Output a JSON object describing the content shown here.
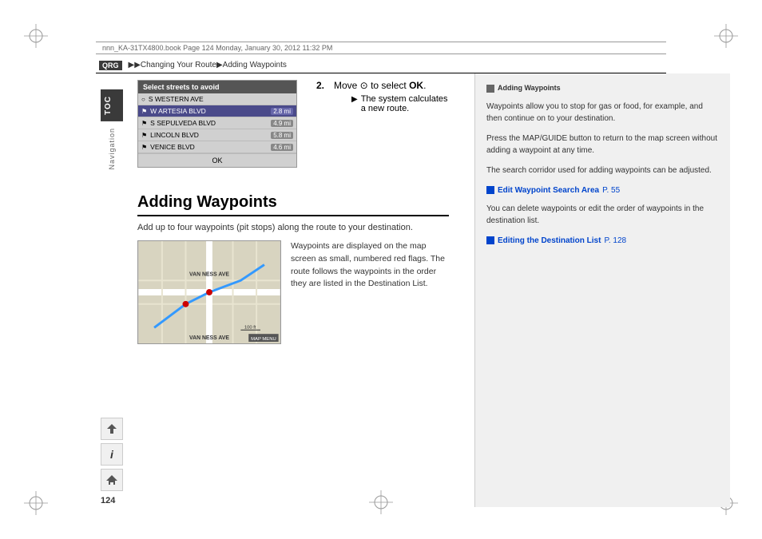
{
  "meta": {
    "file_info": "nnn_KA-31TX4800.book  Page 124  Monday, January 30, 2012  11:32 PM"
  },
  "header": {
    "qrg_label": "QRG",
    "breadcrumb": "▶▶Changing Your Route▶Adding Waypoints"
  },
  "sidebar": {
    "toc_label": "TOC",
    "nav_label": "Navigation",
    "icons": [
      "↗",
      "i",
      "Home"
    ],
    "page_number": "124"
  },
  "step2": {
    "label": "2.",
    "text": "Move  to select OK.",
    "joystick": "⊙",
    "ok": "OK",
    "substep": "The system calculates a new route."
  },
  "select_streets": {
    "title": "Select streets to avoid",
    "streets": [
      {
        "icon": "○",
        "name": "S WESTERN AVE",
        "distance": "",
        "selected": false
      },
      {
        "icon": "⚑",
        "name": "W ARTESIA BLVD",
        "distance": "2.8 mi",
        "selected": true
      },
      {
        "icon": "⚑",
        "name": "S SEPULVEDA BLVD",
        "distance": "4.9 mi",
        "selected": false
      },
      {
        "icon": "⚑",
        "name": "LINCOLN BLVD",
        "distance": "5.8 mi",
        "selected": false
      },
      {
        "icon": "⚑",
        "name": "VENICE BLVD",
        "distance": "4.6 mi",
        "selected": false
      }
    ],
    "ok_button": "OK"
  },
  "adding_waypoints": {
    "title": "Adding Waypoints",
    "intro": "Add up to four waypoints (pit stops) along the route to your destination.",
    "description": "Waypoints are displayed on the map screen as small, numbered red flags. The route follows the waypoints in the order they are listed in the Destination List."
  },
  "right_panel": {
    "section_icon": "■",
    "section_title": "Adding Waypoints",
    "paragraphs": [
      "Waypoints allow you to stop for gas or food, for example, and then continue on to your destination.",
      "Press the MAP/GUIDE button to return to the map screen without adding a waypoint at any time.",
      "The search corridor used for adding waypoints can be adjusted."
    ],
    "links": [
      {
        "icon": "■",
        "text": "Edit Waypoint Search Area",
        "page_label": "P. 55"
      },
      {
        "icon": "■",
        "text": "Editing the Destination List",
        "page_label": "P. 128"
      }
    ],
    "link_between_text": "You can delete waypoints or edit the order of waypoints in the destination list."
  }
}
